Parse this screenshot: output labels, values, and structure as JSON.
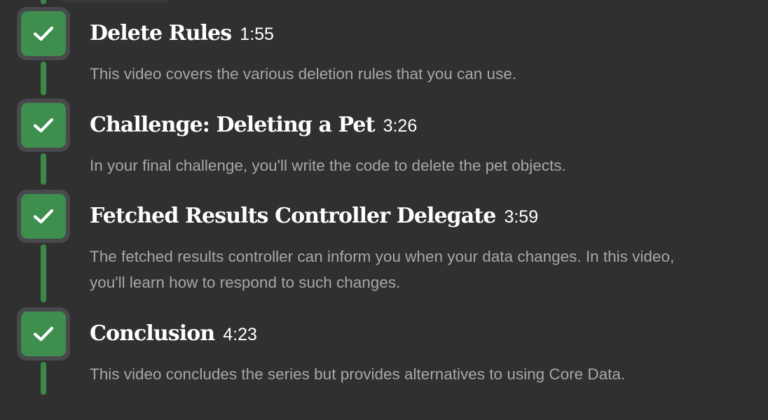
{
  "episodes": [
    {
      "title": "Delete Rules",
      "duration": "1:55",
      "description": "This video covers the various deletion rules that you can use.",
      "completed": true
    },
    {
      "title": "Challenge: Deleting a Pet",
      "duration": "3:26",
      "description": "In your final challenge, you'll write the code to delete the pet objects.",
      "completed": true
    },
    {
      "title": "Fetched Results Controller Delegate",
      "duration": "3:59",
      "description_lines": [
        "The fetched results controller can inform you when your data changes. In this video,",
        "you'll learn how to respond to such changes."
      ],
      "completed": true
    },
    {
      "title": "Conclusion",
      "duration": "4:23",
      "description": "This video concludes the series but provides alternatives to using Core Data.",
      "completed": true
    }
  ],
  "colors": {
    "background": "#303031",
    "complete_green": "#3e8e4d",
    "title_text": "#ffffff",
    "description_text": "#a7a7aa"
  },
  "icons": {
    "completed": "checkmark-icon"
  }
}
